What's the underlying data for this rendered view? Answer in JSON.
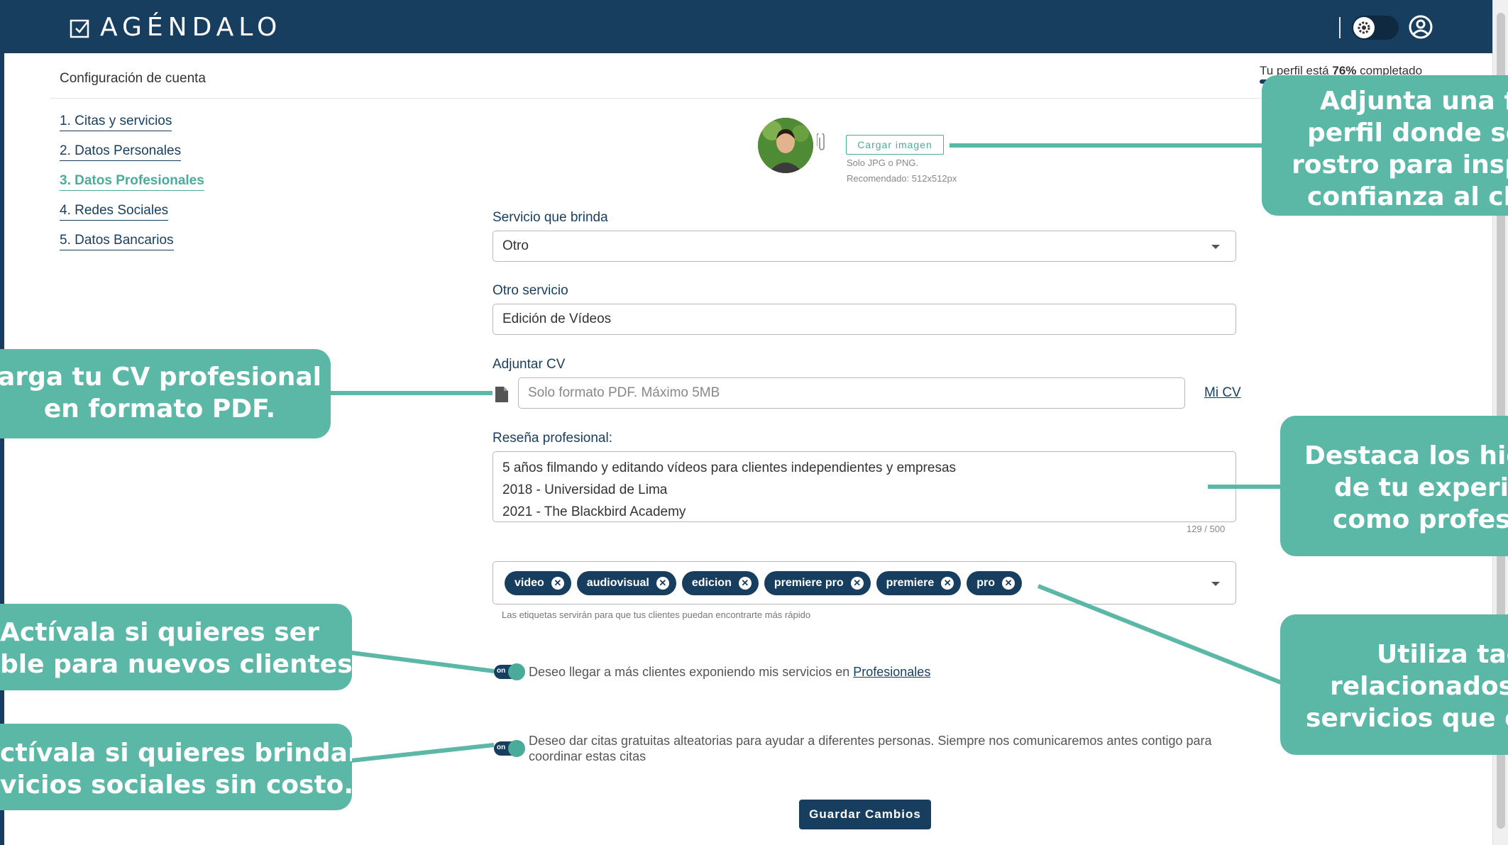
{
  "app": {
    "logo_text": "AGÉNDALO"
  },
  "header": {
    "breadcrumb": "Configuración de cuenta"
  },
  "profile_progress": {
    "prefix": "Tu perfil está",
    "percent_text": "76%",
    "suffix": "completado",
    "value": 0.76
  },
  "nav": {
    "items": [
      {
        "label": "1. Citas y servicios"
      },
      {
        "label": "2. Datos Personales"
      },
      {
        "label": "3. Datos Profesionales",
        "active": true
      },
      {
        "label": "4. Redes Sociales"
      },
      {
        "label": "5. Datos Bancarios"
      }
    ]
  },
  "photo": {
    "upload_label": "Cargar imagen",
    "hint_format": "Solo JPG o PNG.",
    "hint_size": "Recomendado: 512x512px"
  },
  "form": {
    "service": {
      "label": "Servicio que brinda",
      "value": "Otro"
    },
    "other_service": {
      "label": "Otro servicio",
      "value": "Edición de Vídeos"
    },
    "cv": {
      "label": "Adjuntar CV",
      "placeholder": "Solo formato PDF. Máximo 5MB",
      "link": "Mi CV"
    },
    "review": {
      "label": "Reseña profesional:",
      "lines": [
        "5 años filmando y editando vídeos para clientes independientes y empresas",
        "2018 - Universidad de Lima",
        "2021 - The Blackbird Academy"
      ],
      "counter": "129 / 500"
    },
    "tags": {
      "items": [
        "video",
        "audiovisual",
        "edicion",
        "premiere pro",
        "premiere",
        "pro"
      ],
      "hint": "Las etiquetas servirán para que tus clientes puedan encontrarte más rápido"
    },
    "switch_public": {
      "state": "on",
      "text": "Deseo llegar a más clientes exponiendo mis servicios en",
      "link": "Profesionales"
    },
    "switch_free": {
      "state": "on",
      "text_1": "Deseo dar citas gratuitas alteatorias para ayudar a diferentes personas. Siempre nos comunicaremos antes contigo para",
      "text_2": "coordinar estas citas"
    },
    "save_label": "Guardar Cambios"
  },
  "callouts": {
    "photo": [
      "Adjunta una fo",
      "perfil donde se",
      "rostro para inspi",
      "confianza al cl"
    ],
    "cv": [
      "arga tu CV profesional",
      "en formato PDF."
    ],
    "review": [
      "Destaca los hig",
      "de tu experie",
      "como profesi"
    ],
    "public": [
      "Actívala si quieres ser",
      "ble para nuevos clientes."
    ],
    "free": [
      "ctívala si quieres brindar",
      "vicios sociales sin costo."
    ],
    "tags": [
      "Utiliza tag",
      "relacionados",
      "servicios que o"
    ]
  },
  "colors": {
    "navy": "#173e5f",
    "teal": "#4aab9b",
    "callout": "#5bb7a6"
  }
}
